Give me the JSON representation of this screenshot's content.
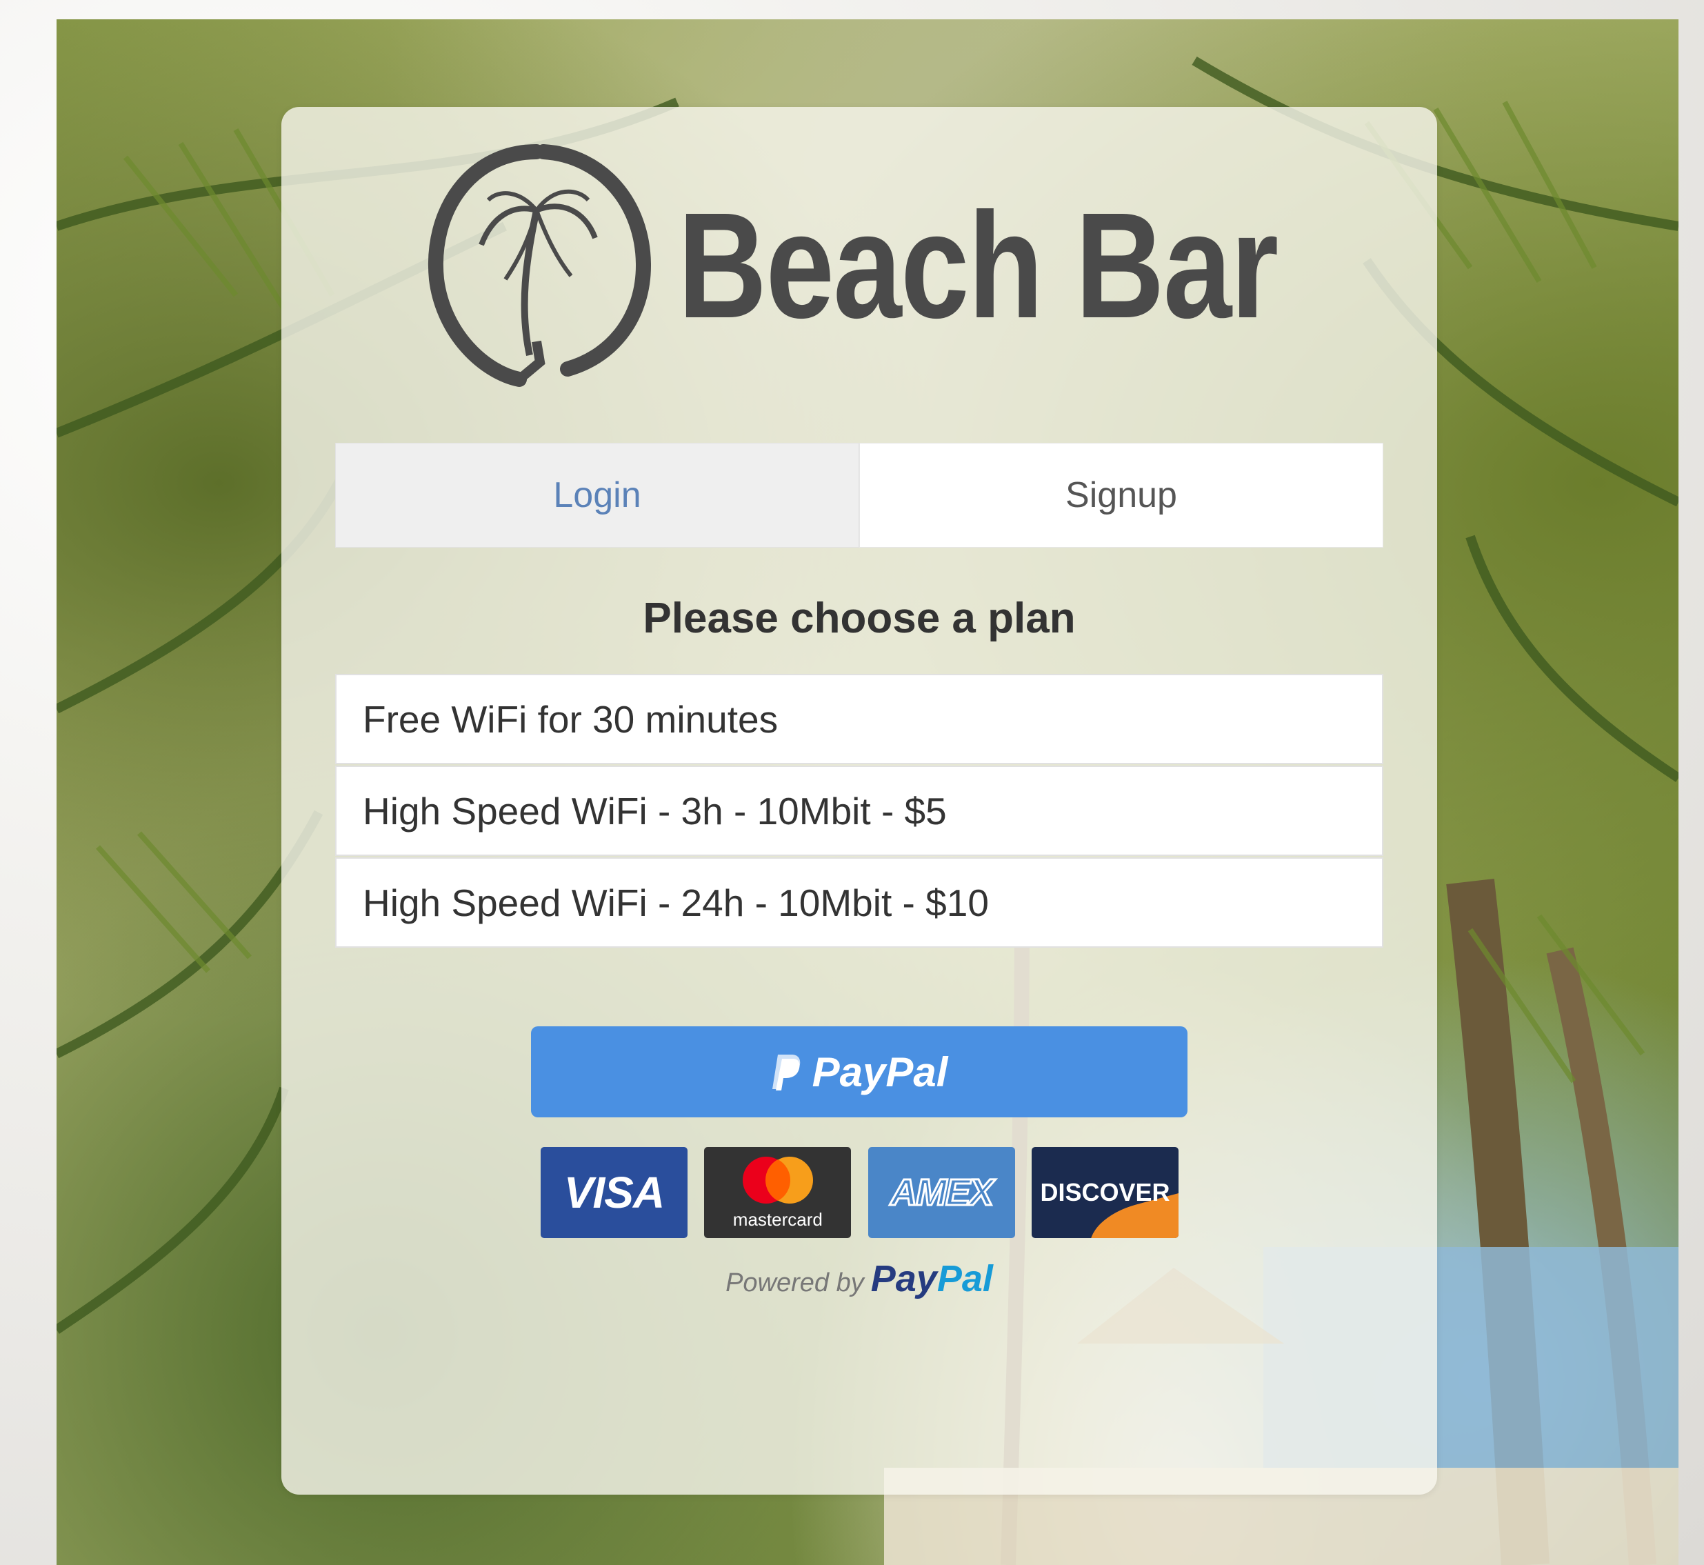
{
  "brand": {
    "name": "Beach Bar",
    "logo_icon": "palm-tree-circle-icon"
  },
  "tabs": [
    {
      "label": "Login",
      "active": true
    },
    {
      "label": "Signup",
      "active": false
    }
  ],
  "plan_heading": "Please choose a plan",
  "plans": [
    "Free WiFi for 30 minutes",
    "High Speed WiFi - 3h - 10Mbit - $5",
    "High Speed WiFi - 24h - 10Mbit - $10"
  ],
  "payment": {
    "button_label": "PayPal",
    "cards": {
      "visa": "VISA",
      "mastercard": "mastercard",
      "amex": "AMEX",
      "discover": "DISCOVER"
    },
    "powered_by": "Powered by",
    "powered_brand_pay": "Pay",
    "powered_brand_pal": "Pal"
  },
  "colors": {
    "tab_active_text": "#5b82b8",
    "paypal_button": "#4a90e2",
    "logo": "#4a4a4a"
  }
}
